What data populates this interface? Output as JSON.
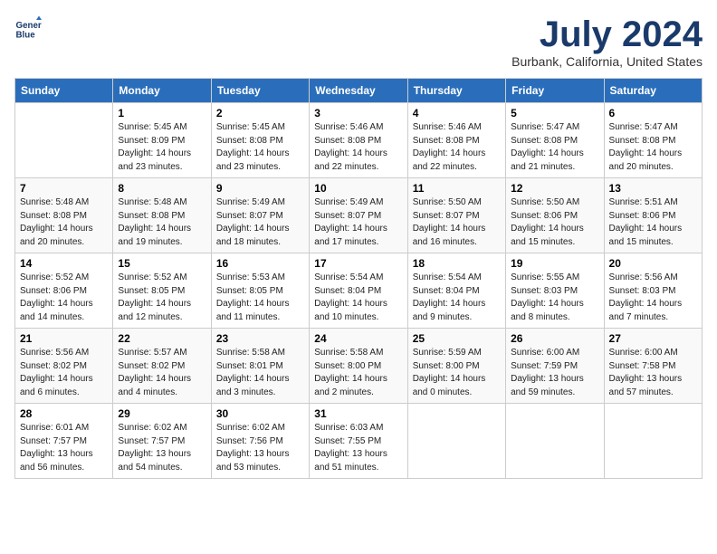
{
  "header": {
    "logo_line1": "General",
    "logo_line2": "Blue",
    "month": "July 2024",
    "location": "Burbank, California, United States"
  },
  "weekdays": [
    "Sunday",
    "Monday",
    "Tuesday",
    "Wednesday",
    "Thursday",
    "Friday",
    "Saturday"
  ],
  "weeks": [
    [
      {
        "day": "",
        "info": ""
      },
      {
        "day": "1",
        "info": "Sunrise: 5:45 AM\nSunset: 8:09 PM\nDaylight: 14 hours\nand 23 minutes."
      },
      {
        "day": "2",
        "info": "Sunrise: 5:45 AM\nSunset: 8:08 PM\nDaylight: 14 hours\nand 23 minutes."
      },
      {
        "day": "3",
        "info": "Sunrise: 5:46 AM\nSunset: 8:08 PM\nDaylight: 14 hours\nand 22 minutes."
      },
      {
        "day": "4",
        "info": "Sunrise: 5:46 AM\nSunset: 8:08 PM\nDaylight: 14 hours\nand 22 minutes."
      },
      {
        "day": "5",
        "info": "Sunrise: 5:47 AM\nSunset: 8:08 PM\nDaylight: 14 hours\nand 21 minutes."
      },
      {
        "day": "6",
        "info": "Sunrise: 5:47 AM\nSunset: 8:08 PM\nDaylight: 14 hours\nand 20 minutes."
      }
    ],
    [
      {
        "day": "7",
        "info": "Sunrise: 5:48 AM\nSunset: 8:08 PM\nDaylight: 14 hours\nand 20 minutes."
      },
      {
        "day": "8",
        "info": "Sunrise: 5:48 AM\nSunset: 8:08 PM\nDaylight: 14 hours\nand 19 minutes."
      },
      {
        "day": "9",
        "info": "Sunrise: 5:49 AM\nSunset: 8:07 PM\nDaylight: 14 hours\nand 18 minutes."
      },
      {
        "day": "10",
        "info": "Sunrise: 5:49 AM\nSunset: 8:07 PM\nDaylight: 14 hours\nand 17 minutes."
      },
      {
        "day": "11",
        "info": "Sunrise: 5:50 AM\nSunset: 8:07 PM\nDaylight: 14 hours\nand 16 minutes."
      },
      {
        "day": "12",
        "info": "Sunrise: 5:50 AM\nSunset: 8:06 PM\nDaylight: 14 hours\nand 15 minutes."
      },
      {
        "day": "13",
        "info": "Sunrise: 5:51 AM\nSunset: 8:06 PM\nDaylight: 14 hours\nand 15 minutes."
      }
    ],
    [
      {
        "day": "14",
        "info": "Sunrise: 5:52 AM\nSunset: 8:06 PM\nDaylight: 14 hours\nand 14 minutes."
      },
      {
        "day": "15",
        "info": "Sunrise: 5:52 AM\nSunset: 8:05 PM\nDaylight: 14 hours\nand 12 minutes."
      },
      {
        "day": "16",
        "info": "Sunrise: 5:53 AM\nSunset: 8:05 PM\nDaylight: 14 hours\nand 11 minutes."
      },
      {
        "day": "17",
        "info": "Sunrise: 5:54 AM\nSunset: 8:04 PM\nDaylight: 14 hours\nand 10 minutes."
      },
      {
        "day": "18",
        "info": "Sunrise: 5:54 AM\nSunset: 8:04 PM\nDaylight: 14 hours\nand 9 minutes."
      },
      {
        "day": "19",
        "info": "Sunrise: 5:55 AM\nSunset: 8:03 PM\nDaylight: 14 hours\nand 8 minutes."
      },
      {
        "day": "20",
        "info": "Sunrise: 5:56 AM\nSunset: 8:03 PM\nDaylight: 14 hours\nand 7 minutes."
      }
    ],
    [
      {
        "day": "21",
        "info": "Sunrise: 5:56 AM\nSunset: 8:02 PM\nDaylight: 14 hours\nand 6 minutes."
      },
      {
        "day": "22",
        "info": "Sunrise: 5:57 AM\nSunset: 8:02 PM\nDaylight: 14 hours\nand 4 minutes."
      },
      {
        "day": "23",
        "info": "Sunrise: 5:58 AM\nSunset: 8:01 PM\nDaylight: 14 hours\nand 3 minutes."
      },
      {
        "day": "24",
        "info": "Sunrise: 5:58 AM\nSunset: 8:00 PM\nDaylight: 14 hours\nand 2 minutes."
      },
      {
        "day": "25",
        "info": "Sunrise: 5:59 AM\nSunset: 8:00 PM\nDaylight: 14 hours\nand 0 minutes."
      },
      {
        "day": "26",
        "info": "Sunrise: 6:00 AM\nSunset: 7:59 PM\nDaylight: 13 hours\nand 59 minutes."
      },
      {
        "day": "27",
        "info": "Sunrise: 6:00 AM\nSunset: 7:58 PM\nDaylight: 13 hours\nand 57 minutes."
      }
    ],
    [
      {
        "day": "28",
        "info": "Sunrise: 6:01 AM\nSunset: 7:57 PM\nDaylight: 13 hours\nand 56 minutes."
      },
      {
        "day": "29",
        "info": "Sunrise: 6:02 AM\nSunset: 7:57 PM\nDaylight: 13 hours\nand 54 minutes."
      },
      {
        "day": "30",
        "info": "Sunrise: 6:02 AM\nSunset: 7:56 PM\nDaylight: 13 hours\nand 53 minutes."
      },
      {
        "day": "31",
        "info": "Sunrise: 6:03 AM\nSunset: 7:55 PM\nDaylight: 13 hours\nand 51 minutes."
      },
      {
        "day": "",
        "info": ""
      },
      {
        "day": "",
        "info": ""
      },
      {
        "day": "",
        "info": ""
      }
    ]
  ]
}
